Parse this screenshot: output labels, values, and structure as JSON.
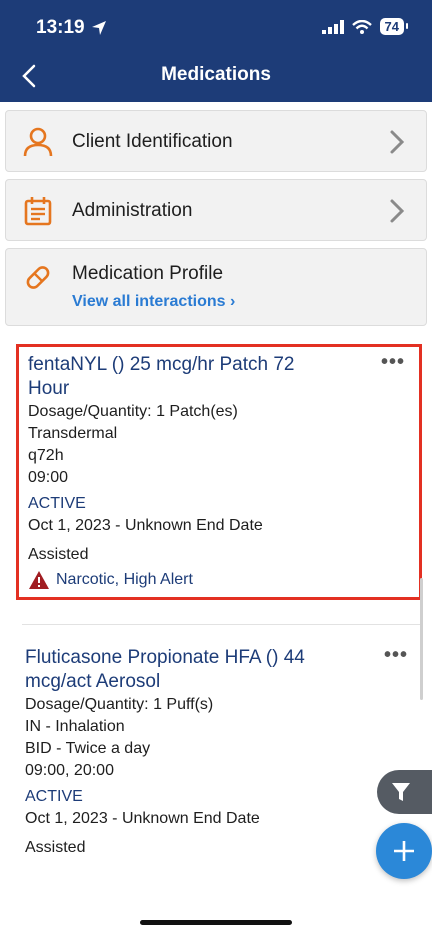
{
  "status_bar": {
    "time": "13:19",
    "battery": "74"
  },
  "nav": {
    "title": "Medications"
  },
  "sections": {
    "client": "Client Identification",
    "administration": "Administration",
    "profile": "Medication Profile",
    "profile_link": "View all interactions ›"
  },
  "medications": [
    {
      "name": "fentaNYL () 25 mcg/hr Patch 72 Hour",
      "dosage": "Dosage/Quantity: 1 Patch(es)",
      "route": "Transdermal",
      "frequency": "q72h",
      "times": "09:00",
      "status": "ACTIVE",
      "dates": "Oct 1, 2023  - Unknown End Date",
      "assisted": "Assisted",
      "alert": "Narcotic, High Alert",
      "more": "•••"
    },
    {
      "name": "Fluticasone Propionate HFA () 44 mcg/act Aerosol",
      "dosage": "Dosage/Quantity: 1 Puff(s)",
      "route": "IN - Inhalation",
      "frequency": "BID - Twice a day",
      "times": "09:00, 20:00",
      "status": "ACTIVE",
      "dates": "Oct 1, 2023  - Unknown End Date",
      "assisted": "Assisted",
      "more": "•••"
    }
  ],
  "colors": {
    "header": "#1d3c78",
    "accent_orange": "#e5761f",
    "link_blue": "#2a7bd3",
    "highlight_red": "#e33022",
    "fab_blue": "#2b88d8"
  },
  "icons": [
    "location-arrow-icon",
    "signal-icon",
    "wifi-icon",
    "battery-icon",
    "back-chevron-icon",
    "person-icon",
    "calendar-icon",
    "pill-icon",
    "chevron-right-icon",
    "warning-icon",
    "more-icon",
    "filter-icon",
    "plus-icon"
  ]
}
